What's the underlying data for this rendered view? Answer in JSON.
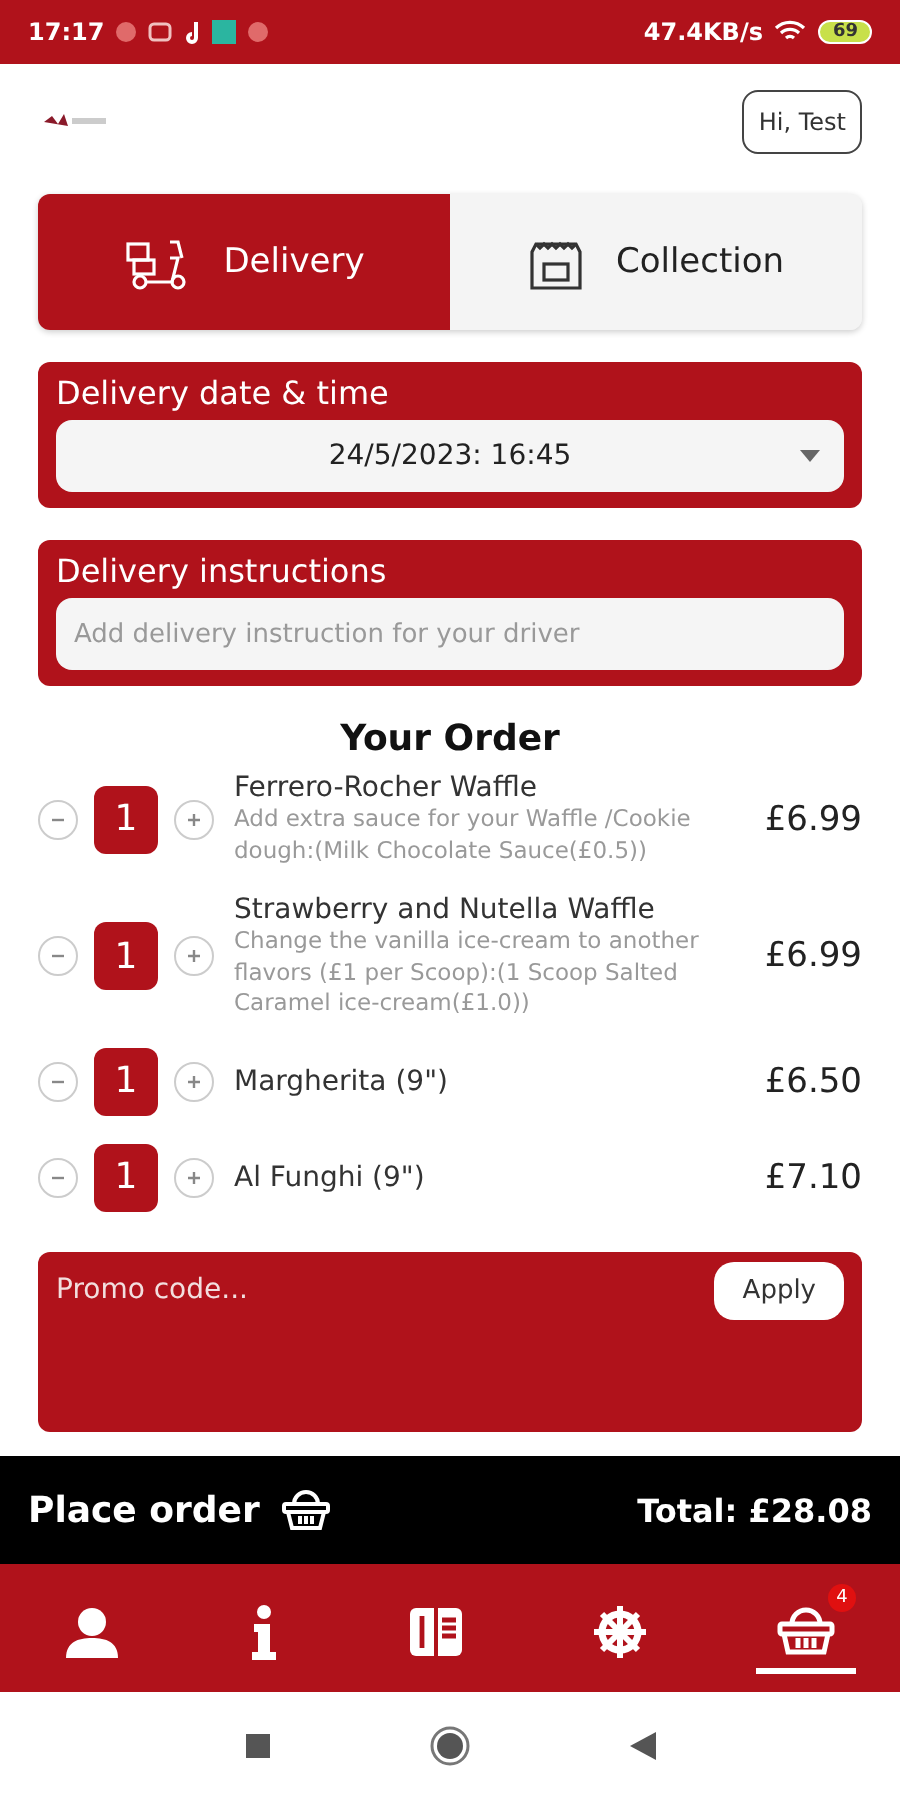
{
  "status_bar": {
    "time": "17:17",
    "speed": "47.4KB/s",
    "battery": "69"
  },
  "header": {
    "greeting": "Hi, Test"
  },
  "tabs": [
    {
      "label": "Delivery",
      "kind": "scooter",
      "selected": true
    },
    {
      "label": "Collection",
      "kind": "bag",
      "selected": false
    }
  ],
  "date_time": {
    "label": "Delivery date & time",
    "value": "24/5/2023: 16:45"
  },
  "instructions": {
    "label": "Delivery instructions",
    "placeholder": "Add delivery instruction for your driver"
  },
  "order": {
    "title": "Your Order",
    "items": [
      {
        "name": "Ferrero-Rocher Waffle",
        "details": "Add extra sauce for your Waffle /Cookie dough:(Milk Chocolate Sauce(£0.5))",
        "quantity": "1",
        "price": "£6.99"
      },
      {
        "name": "Strawberry and Nutella Waffle",
        "details": "Change the vanilla ice-cream to another flavors (£1 per Scoop):(1 Scoop Salted Caramel ice-cream(£1.0))",
        "quantity": "1",
        "price": "£6.99"
      },
      {
        "name": "Margherita (9\")",
        "quantity": "1",
        "price": "£6.50"
      },
      {
        "name": "Al Funghi (9\")",
        "quantity": "1",
        "price": "£7.10"
      }
    ]
  },
  "promo": {
    "placeholder": "Promo code...",
    "button": "Apply"
  },
  "order_bar": {
    "button": "Place order",
    "total": "Total: £28.08"
  },
  "nav": [
    {
      "kind": "user",
      "selected": false
    },
    {
      "kind": "info",
      "selected": false
    },
    {
      "kind": "menu",
      "selected": false
    },
    {
      "kind": "wheel",
      "selected": false
    },
    {
      "kind": "basket",
      "selected": true,
      "badge": "4"
    }
  ]
}
